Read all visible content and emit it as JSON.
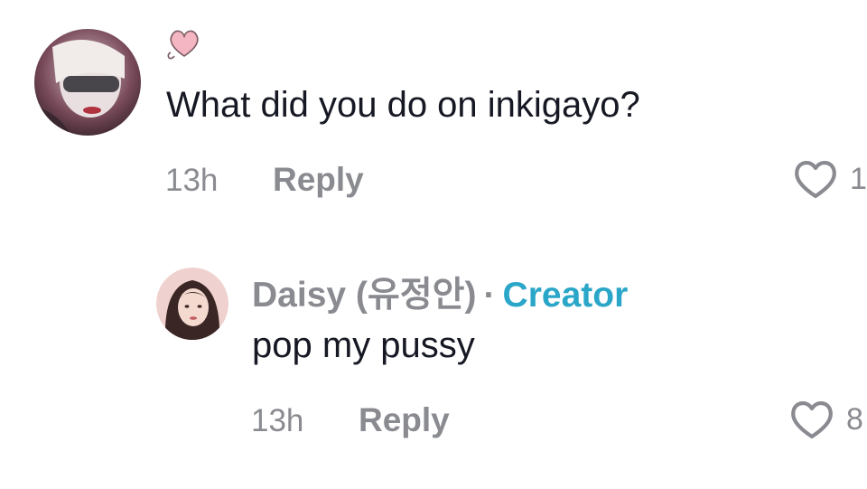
{
  "comment": {
    "avatar_alt": "user-avatar",
    "text": "What did you do on inkigayo?",
    "time": "13h",
    "reply_label": "Reply",
    "like_count": "1"
  },
  "reply_comment": {
    "author": "Daisy (유정안)",
    "separator": "·",
    "badge": "Creator",
    "text": "pop my pussy",
    "time": "13h",
    "reply_label": "Reply",
    "like_count": "8"
  },
  "colors": {
    "text": "#161823",
    "meta": "#8a8b91",
    "creator_badge": "#2aa6c9",
    "heart_sticker": "#f4b6c2"
  }
}
